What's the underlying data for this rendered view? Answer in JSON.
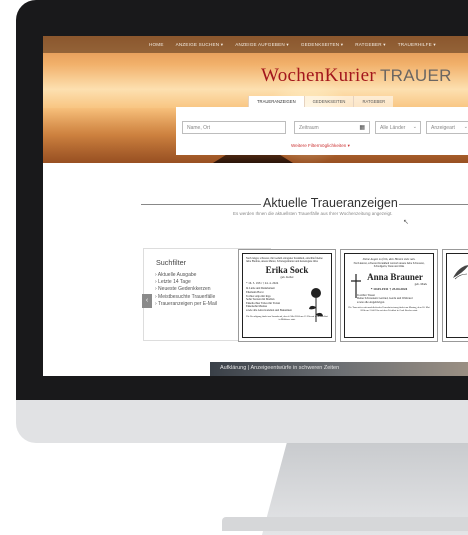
{
  "nav": [
    "HOME",
    "ANZEIGE SUCHEN ▾",
    "ANZEIGE AUFGEBEN ▾",
    "GEDENKSEITEN ▾",
    "RATGEBER ▾",
    "TRAUERHILFE ▾"
  ],
  "logo": {
    "part1": "WochenKurier",
    "part2": "TRAUER"
  },
  "tabs": [
    "TRAUERANZEIGEN",
    "GEDENKSEITEN",
    "RATGEBER"
  ],
  "search": {
    "name_placeholder": "Name, Ort",
    "timeframe_placeholder": "Zeitraum",
    "region_value": "Alle Länder",
    "type_value": "Anzeigeart",
    "more_filters": "Weitere Filtermöglichkeiten ▾"
  },
  "section": {
    "title": "Aktuelle Traueranzeigen",
    "subtitle": "Es werden Ihnen die aktuellsten Trauerfälle aus Ihrer Wochenzeitung angezeigt."
  },
  "filter": {
    "title": "Suchfilter",
    "items": [
      "› Aktuelle Ausgabe",
      "› Letzte 14 Tage",
      "› Neueste Gedenkkerzen",
      "› Meistbesuchte Trauerfälle",
      "› Traueranzeigen per E-Mail"
    ]
  },
  "cards": [
    {
      "intro": "Nach langer, schwerer, mit Geduld ertragener Krankheit, entschlief meine liebe Ehefrau, unsere Mutter, Schwiegermutter und herzensgute Oma",
      "name": "Erika Sock",
      "maiden": "geb. Keller",
      "dates": "* 16. 5. 1951    † 24. 4. 2024",
      "mourners": "In Liebe und Dankbarkeit\nEhemann Horst\nTochter Anja mit Ingo\nSohn Torsten mit Madlen\nEnkeltochter Tabea mit Yorian\nEnkelsohn Markus\nsowie alle Anverwandten und Bekannten",
      "footer": "Die Beerdigung findet am Sonnabend, dem 4. Mai 2024 um 13 Uhr auf dem Friedhof in Mühlrose statt."
    },
    {
      "intro": "Deine Augen zu früh, dem Herzen stets nah.",
      "intro2": "Nach kurzer, schwerer Krankheit verstarb unsere liebe Schwester, Schwägerin, Tante und Oma",
      "name": "Anna Brauner",
      "maiden": "geb. Mark",
      "dates": "* 10.05.1931   † 23.04.2024",
      "mourners": "In stiller Trauer\nDeine Schwestern Gertrud, Gerda und Waltraud\nsowie alle Angehörigen",
      "footer": "Die Trauerfeier mit anschließender Urnenbeisetzung findet am Montag, dem 20. Mai 2024 um 13:00 Uhr auf dem Friedhof in Groß Särchen statt."
    }
  ],
  "bottom_strip": "Aufklärung | Anzeigeentwürfe in schweren Zeiten"
}
